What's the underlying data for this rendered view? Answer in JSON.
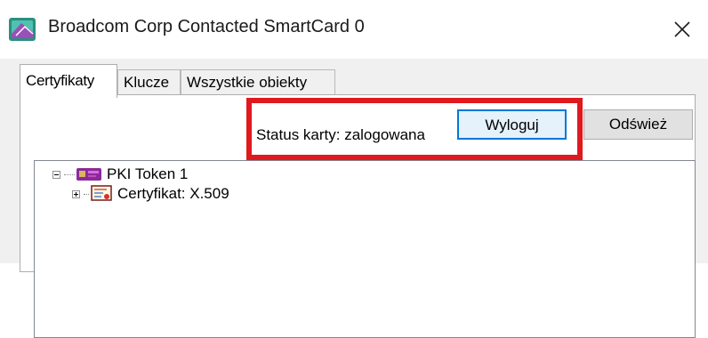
{
  "window": {
    "title": "Broadcom Corp Contacted SmartCard 0",
    "close_symbol": "✕"
  },
  "tabs": [
    {
      "label": "Certyfikaty",
      "active": true
    },
    {
      "label": "Klucze",
      "active": false
    },
    {
      "label": "Wszystkie obiekty",
      "active": false
    }
  ],
  "status": {
    "label": "Status karty: zalogowana",
    "highlight_color": "#e0191e"
  },
  "buttons": {
    "logout": "Wyloguj",
    "refresh": "Odśwież"
  },
  "tree": {
    "root": {
      "label": "PKI Token 1",
      "icon": "smartcard-token-icon",
      "expanded": true
    },
    "child": {
      "label": "Certyfikat: X.509",
      "icon": "certificate-icon",
      "expanded": false
    }
  },
  "colors": {
    "accent": "#0078d7",
    "highlight": "#e0191e"
  }
}
